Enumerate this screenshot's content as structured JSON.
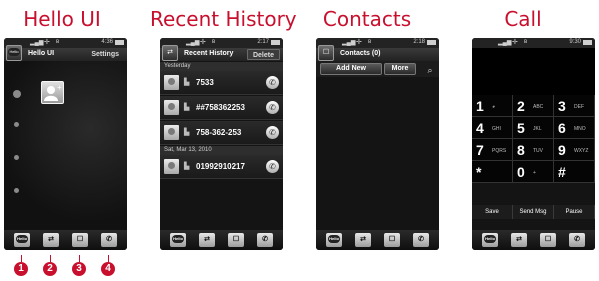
{
  "captions": [
    "Hello UI",
    "Recent History",
    "Contacts",
    "Call"
  ],
  "markers": [
    "1",
    "2",
    "3",
    "4"
  ],
  "accent_color": "#c8102e",
  "status": {
    "screen1_time": "4:36",
    "screen2_time": "2:17",
    "screen3_time": "2:18",
    "screen4_time": "9:30",
    "signal_icon": "signal-bars-icon",
    "battery_icon": "battery-icon"
  },
  "hello": {
    "title": "Hello UI",
    "settings_label": "Settings",
    "badge": "Hello",
    "add_contact_icon": "add-contact-icon"
  },
  "recent": {
    "title": "Recent History",
    "delete_label": "Delete",
    "sections": [
      "Yesterday",
      "Sat, Mar 13, 2010"
    ],
    "entries": [
      "7533",
      "##758362253",
      "758-362-253",
      "01992910217"
    ]
  },
  "contacts": {
    "title": "Contacts (0)",
    "add_new_label": "Add New",
    "more_label": "More",
    "search_icon": "search-icon"
  },
  "call": {
    "keys": [
      {
        "digit": "1",
        "letters": ""
      },
      {
        "digit": "2",
        "letters": "ABC"
      },
      {
        "digit": "3",
        "letters": "DEF"
      },
      {
        "digit": "4",
        "letters": "GHI"
      },
      {
        "digit": "5",
        "letters": "JKL"
      },
      {
        "digit": "6",
        "letters": "MNO"
      },
      {
        "digit": "7",
        "letters": "PQRS"
      },
      {
        "digit": "8",
        "letters": "TUV"
      },
      {
        "digit": "9",
        "letters": "WXYZ"
      },
      {
        "digit": "*",
        "letters": ""
      },
      {
        "digit": "0",
        "letters": "+"
      },
      {
        "digit": "#",
        "letters": ""
      }
    ],
    "save_label": "Save",
    "send_msg_label": "Send Msg",
    "pause_label": "Pause"
  },
  "dock": {
    "hello_label": "Hello",
    "icons": [
      "hello-icon",
      "recent-history-icon",
      "contacts-icon",
      "call-icon"
    ]
  }
}
